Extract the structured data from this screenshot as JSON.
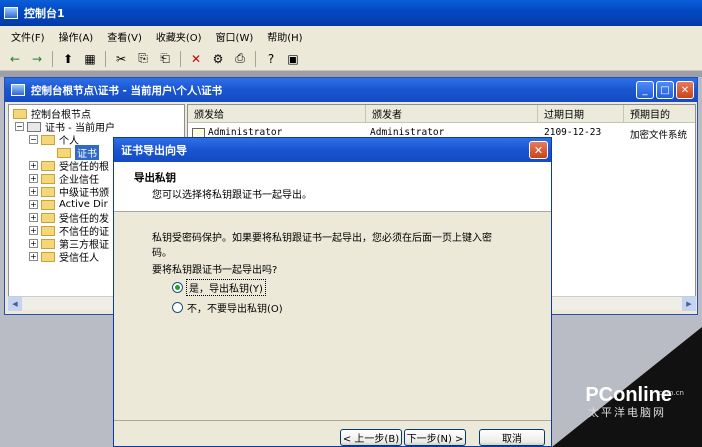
{
  "app": {
    "title": "控制台1"
  },
  "menu": [
    "文件(F)",
    "操作(A)",
    "查看(V)",
    "收藏夹(O)",
    "窗口(W)",
    "帮助(H)"
  ],
  "toolbar": [
    "←",
    "→",
    "⬆",
    "▦",
    "✂",
    "⎘",
    "⎗",
    "✕",
    "⚙",
    "⎙",
    "?",
    "▣"
  ],
  "inner": {
    "title": "控制台根节点\\证书 - 当前用户\\个人\\证书",
    "tree": [
      {
        "label": "控制台根节点"
      },
      {
        "label": "证书 - 当前用户"
      },
      {
        "label": "个人"
      },
      {
        "label": "证书"
      },
      {
        "label": "受信任的根"
      },
      {
        "label": "企业信任"
      },
      {
        "label": "中级证书颁"
      },
      {
        "label": "Active Dir"
      },
      {
        "label": "受信任的发"
      },
      {
        "label": "不信任的证"
      },
      {
        "label": "第三方根证"
      },
      {
        "label": "受信任人"
      }
    ],
    "columns": [
      "颁发给",
      "颁发者",
      "过期日期",
      "预期目的"
    ],
    "row": {
      "issued_to": "Administrator",
      "issuer": "Administrator",
      "expires": "2109-12-23",
      "purpose": "加密文件系统"
    }
  },
  "dialog": {
    "title": "证书导出向导",
    "heading": "导出私钥",
    "subheading": "您可以选择将私钥跟证书一起导出。",
    "para1": "私钥受密码保护。如果要将私钥跟证书一起导出，您必须在后面一页上键入密",
    "para1b": "码。",
    "question": "要将私钥跟证书一起导出吗?",
    "options": [
      {
        "label": "是，导出私钥(Y)",
        "selected": true
      },
      {
        "label": "不，不要导出私钥(O)",
        "selected": false
      }
    ],
    "buttons": {
      "back": "< 上一步(B)",
      "next": "下一步(N) >",
      "cancel": "取消"
    }
  },
  "watermark": {
    "brand": "PConline",
    "sub": "太平洋电脑网",
    "domain": ".com.cn"
  }
}
